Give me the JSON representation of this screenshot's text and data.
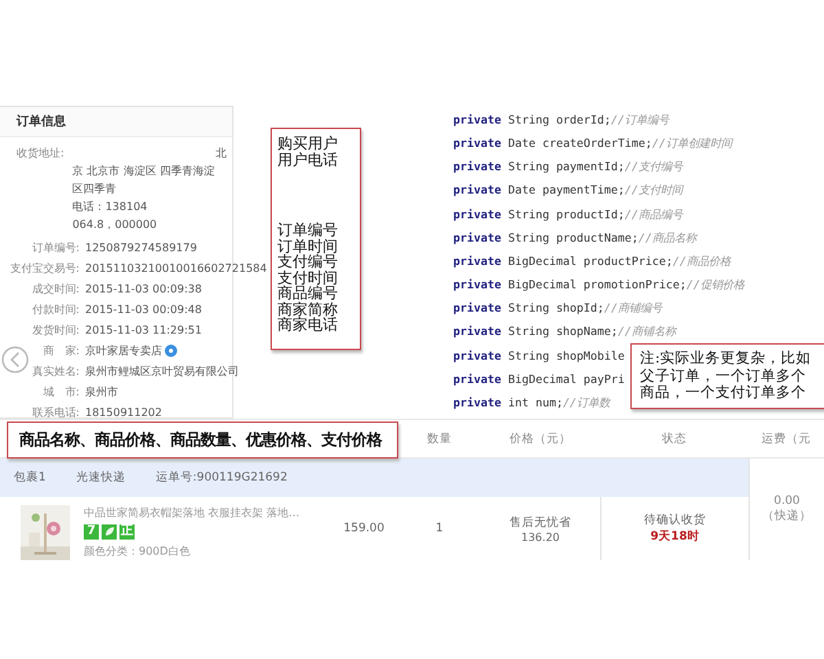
{
  "order_info": {
    "title": "订单信息",
    "address_label": "收货地址:",
    "address_lines": [
      "北",
      "京 北京市 海淀区 四季青海淀",
      "区四季青",
      "电话：138104",
      "064.8，000000"
    ],
    "fields": [
      {
        "kind": "text",
        "label": "订单编号:",
        "value": "1250879274589179"
      },
      {
        "kind": "text",
        "label": "支付宝交易号:",
        "value": "20151103210010016602721584"
      },
      {
        "kind": "text",
        "label": "成交时间:",
        "value": "2015-11-03 00:09:38"
      },
      {
        "kind": "text",
        "label": "付款时间:",
        "value": "2015-11-03 00:09:48"
      },
      {
        "kind": "text",
        "label": "发货时间:",
        "value": "2015-11-03 11:29:51"
      },
      {
        "kind": "shop",
        "label": "商　家:",
        "value": "京叶家居专卖店"
      },
      {
        "kind": "text",
        "label": "真实姓名:",
        "value": "泉州市鲤城区京叶贸易有限公司"
      },
      {
        "kind": "text",
        "label": "城　市:",
        "value": "泉州市"
      },
      {
        "kind": "text",
        "label": "联系电话:",
        "value": "18150911202"
      }
    ]
  },
  "field_note": {
    "groups": [
      [
        "购买用户",
        "用户电话"
      ],
      [
        "订单编号",
        "订单时间",
        "支付编号",
        "支付时间",
        "商品编号",
        "商家简称",
        "商家电话"
      ]
    ]
  },
  "code": {
    "lines": [
      {
        "modifier": "private",
        "type": "String",
        "rest": "orderId;",
        "comment": "//订单编号"
      },
      {
        "modifier": "private",
        "type": "Date",
        "rest": "createOrderTime;",
        "comment": "//订单创建时间"
      },
      {
        "modifier": "private",
        "type": "String",
        "rest": "paymentId;",
        "comment": "//支付编号"
      },
      {
        "modifier": "private",
        "type": "Date",
        "rest": "paymentTime;",
        "comment": "//支付时间"
      },
      {
        "modifier": "private",
        "type": "String",
        "rest": "productId;",
        "comment": "//商品编号"
      },
      {
        "modifier": "private",
        "type": "String",
        "rest": "productName;",
        "comment": "//商品名称"
      },
      {
        "modifier": "private",
        "type": "BigDecimal",
        "rest": "productPrice;",
        "comment": "//商品价格"
      },
      {
        "modifier": "private",
        "type": "BigDecimal",
        "rest": "promotionPrice;",
        "comment": "//促销价格"
      },
      {
        "modifier": "private",
        "type": "String",
        "rest": "shopId;",
        "comment": "//商铺编号"
      },
      {
        "modifier": "private",
        "type": "String",
        "rest": "shopName;",
        "comment": "//商铺名称"
      },
      {
        "modifier": "private",
        "type": "String",
        "rest": "shopMobile"
      },
      {
        "modifier": "private",
        "type": "BigDecimal",
        "rest": "payPri"
      },
      {
        "modifier": "private",
        "type": "int",
        "rest": "num;",
        "comment": "//订单数"
      }
    ]
  },
  "remark_note": {
    "text": "注:实际业务更复杂，比如父子订单，一个订单多个商品，一个支付订单多个"
  },
  "product_note": {
    "text": "商品名称、商品价格、商品数量、优惠价格、支付价格"
  },
  "table": {
    "columns": [
      "数量",
      "价格（元）",
      "状态",
      "运费（元"
    ],
    "package": {
      "label": "包裹1",
      "carrier": "光速快递",
      "tracking": "运单号:900119G21692"
    },
    "item": {
      "kind": "picture",
      "title": "中品世家简易衣帽架落地 衣服挂衣架 落地…",
      "badges": [
        {
          "kind": "text",
          "text": "7"
        },
        {
          "kind": "icon"
        },
        {
          "kind": "text",
          "text": "正"
        }
      ],
      "attribute": "颜色分类：900D白色",
      "price": "159.00",
      "quantity": "1",
      "discount_label": "售后无忧省",
      "discount": "136.20",
      "status": "待确认收货",
      "countdown": "9天18时",
      "freight": "0.00",
      "freight_type": "（快递）"
    }
  }
}
